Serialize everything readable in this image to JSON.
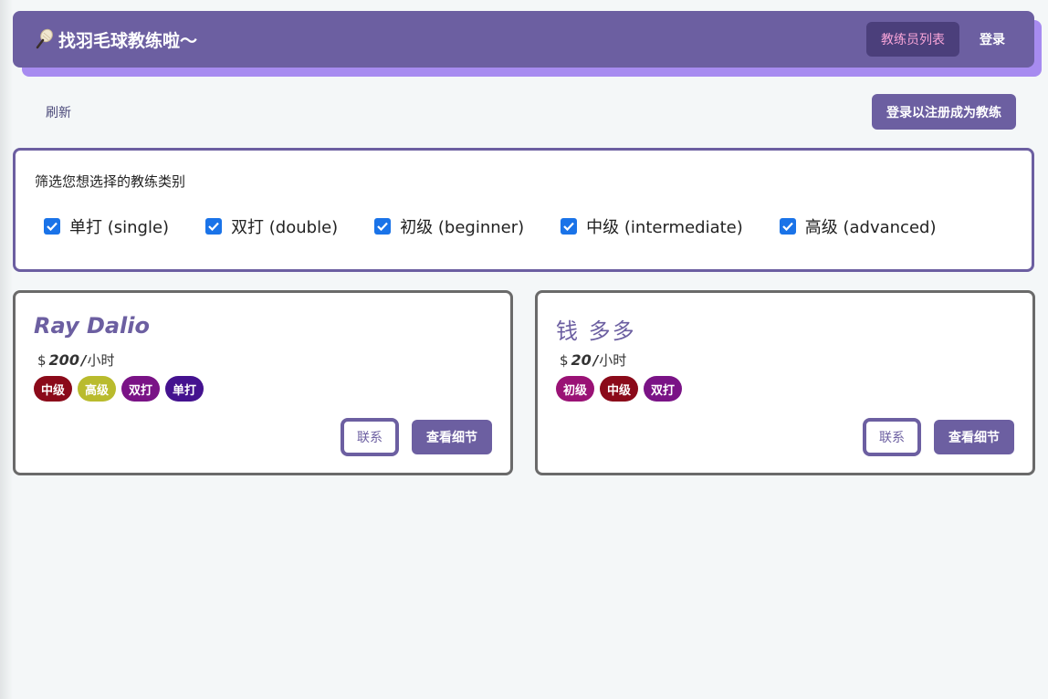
{
  "navbar": {
    "brand_icon": "badminton-racket-icon",
    "brand_title": "找羽毛球教练啦～",
    "coach_list_label": "教练员列表",
    "login_label": "登录"
  },
  "toolbar": {
    "refresh_label": "刷新",
    "register_label": "登录以注册成为教练"
  },
  "filter": {
    "title": "筛选您想选择的教练类别",
    "options": [
      {
        "label": "单打 (single)",
        "checked": true
      },
      {
        "label": "双打 (double)",
        "checked": true
      },
      {
        "label": "初级 (beginner)",
        "checked": true
      },
      {
        "label": "中级 (intermediate)",
        "checked": true
      },
      {
        "label": "高级 (advanced)",
        "checked": true
      }
    ]
  },
  "coaches": [
    {
      "name": "Ray Dalio",
      "currency": "$",
      "price": "200",
      "unit": "小时",
      "tags": [
        {
          "label": "中级",
          "color": "#8b0a1a"
        },
        {
          "label": "高级",
          "color": "#b9bb2d"
        },
        {
          "label": "双打",
          "color": "#7a1386"
        },
        {
          "label": "单打",
          "color": "#44128f"
        }
      ],
      "contact_label": "联系",
      "detail_label": "查看细节"
    },
    {
      "name": "钱 多多",
      "currency": "$",
      "price": "20",
      "unit": "小时",
      "tags": [
        {
          "label": "初级",
          "color": "#9a1275"
        },
        {
          "label": "中级",
          "color": "#8b0a1a"
        },
        {
          "label": "双打",
          "color": "#7a1386"
        }
      ],
      "contact_label": "联系",
      "detail_label": "查看细节"
    }
  ],
  "colors": {
    "primary": "#6c5fa1",
    "primary_dark": "#4b3f7b",
    "accent_shadow": "#a78bf0",
    "active_text": "#f8a5d8",
    "checkbox": "#1a73e8"
  }
}
